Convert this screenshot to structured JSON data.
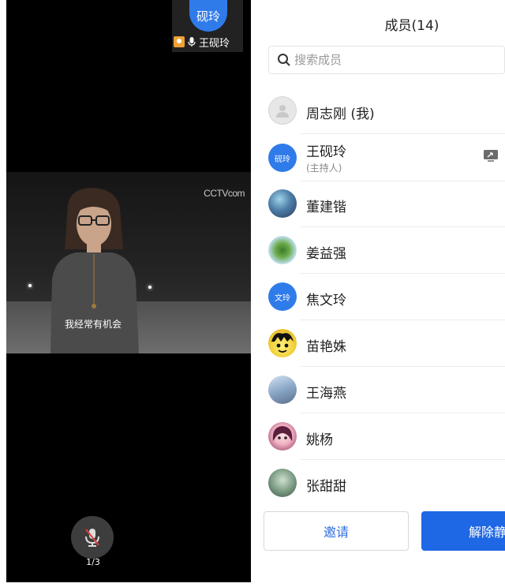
{
  "video": {
    "speaker_avatar_text": "砚玲",
    "speaker_name": "王砚玲",
    "cctv_logo": "CCTV",
    "cctv_logo_suffix": "com",
    "subtitle": "我经常有机会",
    "page_indicator": "1/3",
    "icons": [
      "host-badge-icon",
      "mic-icon",
      "mic-muted-icon"
    ]
  },
  "members_panel": {
    "title": "成员(14)",
    "search": {
      "placeholder": "搜索成员",
      "value": ""
    },
    "members": [
      {
        "name": "周志刚 (我)",
        "avatar_type": "default-person",
        "avatar_text": ""
      },
      {
        "name": "王砚玲",
        "subtitle": "(主持人)",
        "avatar_type": "text",
        "avatar_text": "砚玲",
        "avatar_color": "#2f7bea",
        "status_icon": "share-screen-icon"
      },
      {
        "name": "董建锴",
        "avatar_type": "photo",
        "avatar_text": ""
      },
      {
        "name": "姜益强",
        "avatar_type": "photo",
        "avatar_text": ""
      },
      {
        "name": "焦文玲",
        "avatar_type": "text",
        "avatar_text": "文玲",
        "avatar_color": "#2f7bea"
      },
      {
        "name": "苗艳姝",
        "avatar_type": "photo",
        "avatar_text": ""
      },
      {
        "name": "王海燕",
        "avatar_type": "photo",
        "avatar_text": ""
      },
      {
        "name": "姚杨",
        "avatar_type": "photo",
        "avatar_text": ""
      },
      {
        "name": "张甜甜",
        "avatar_type": "photo",
        "avatar_text": ""
      }
    ],
    "buttons": {
      "invite": "邀请",
      "unmute_all": "解除静音"
    }
  },
  "colors": {
    "accent": "#1e67e5",
    "avatar_blue": "#2f7bea",
    "host_badge": "#f0a232"
  }
}
